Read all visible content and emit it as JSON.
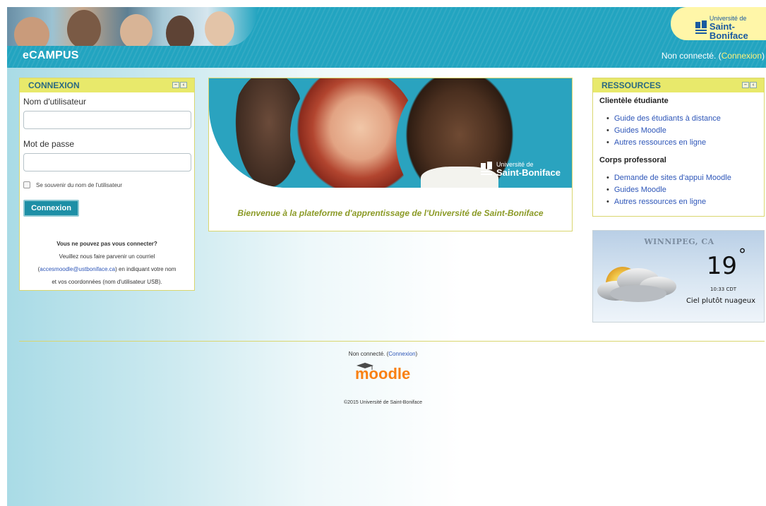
{
  "header": {
    "site_title": "eCAMPUS",
    "login_status_prefix": "Non connecté. (",
    "login_link": "Connexion",
    "login_status_suffix": ")",
    "logo": {
      "line1": "Université de",
      "line2": "Saint-Boniface"
    }
  },
  "login_block": {
    "title": "CONNEXION",
    "username_label": "Nom d'utilisateur",
    "username_value": "",
    "password_label": "Mot de passe",
    "password_value": "",
    "remember_label": "Se souvenir du nom de l'utilisateur",
    "remember_checked": false,
    "submit_label": "Connexion",
    "help_question": "Vous ne pouvez pas vous connecter?",
    "help_line1": "Veuillez nous faire parvenir un courriel",
    "help_line2_open": "(",
    "help_email": "accesmoodle@ustboniface.ca",
    "help_line2_rest": ") en indiquant votre nom",
    "help_line3": "et vos coordonnées (nom d'utilisateur USB)."
  },
  "center": {
    "hero_logo": {
      "line1": "Université de",
      "line2": "Saint-Boniface"
    },
    "welcome": "Bienvenue à la plateforme d'apprentissage de l'Université de Saint-Boniface"
  },
  "resources": {
    "title": "RESSOURCES",
    "sections": [
      {
        "heading": "Clientèle étudiante",
        "links": [
          "Guide des étudiants à distance",
          "Guides Moodle",
          "Autres ressources en ligne"
        ]
      },
      {
        "heading": "Corps professoral",
        "links": [
          "Demande de sites d'appui Moodle",
          "Guides Moodle",
          "Autres ressources en ligne"
        ]
      }
    ]
  },
  "weather": {
    "city": "WINNIPEG, CA",
    "temperature": "19",
    "degree_symbol": "°",
    "time": "10:33 CDT",
    "condition": "Ciel plutôt nuageux",
    "icon": "partly-cloudy-icon"
  },
  "footer": {
    "status_prefix": "Non connecté. (",
    "login_link": "Connexion",
    "status_suffix": ")",
    "logo_text": "moodle",
    "copyright": "©2015 Université de Saint-Boniface"
  },
  "colors": {
    "header_teal": "#22a4c0",
    "block_header_yellow": "#e8e96b",
    "link_blue": "#2e56b8",
    "button_teal": "#1d8fa6",
    "welcome_olive": "#8b9a26",
    "moodle_orange": "#f98012"
  }
}
